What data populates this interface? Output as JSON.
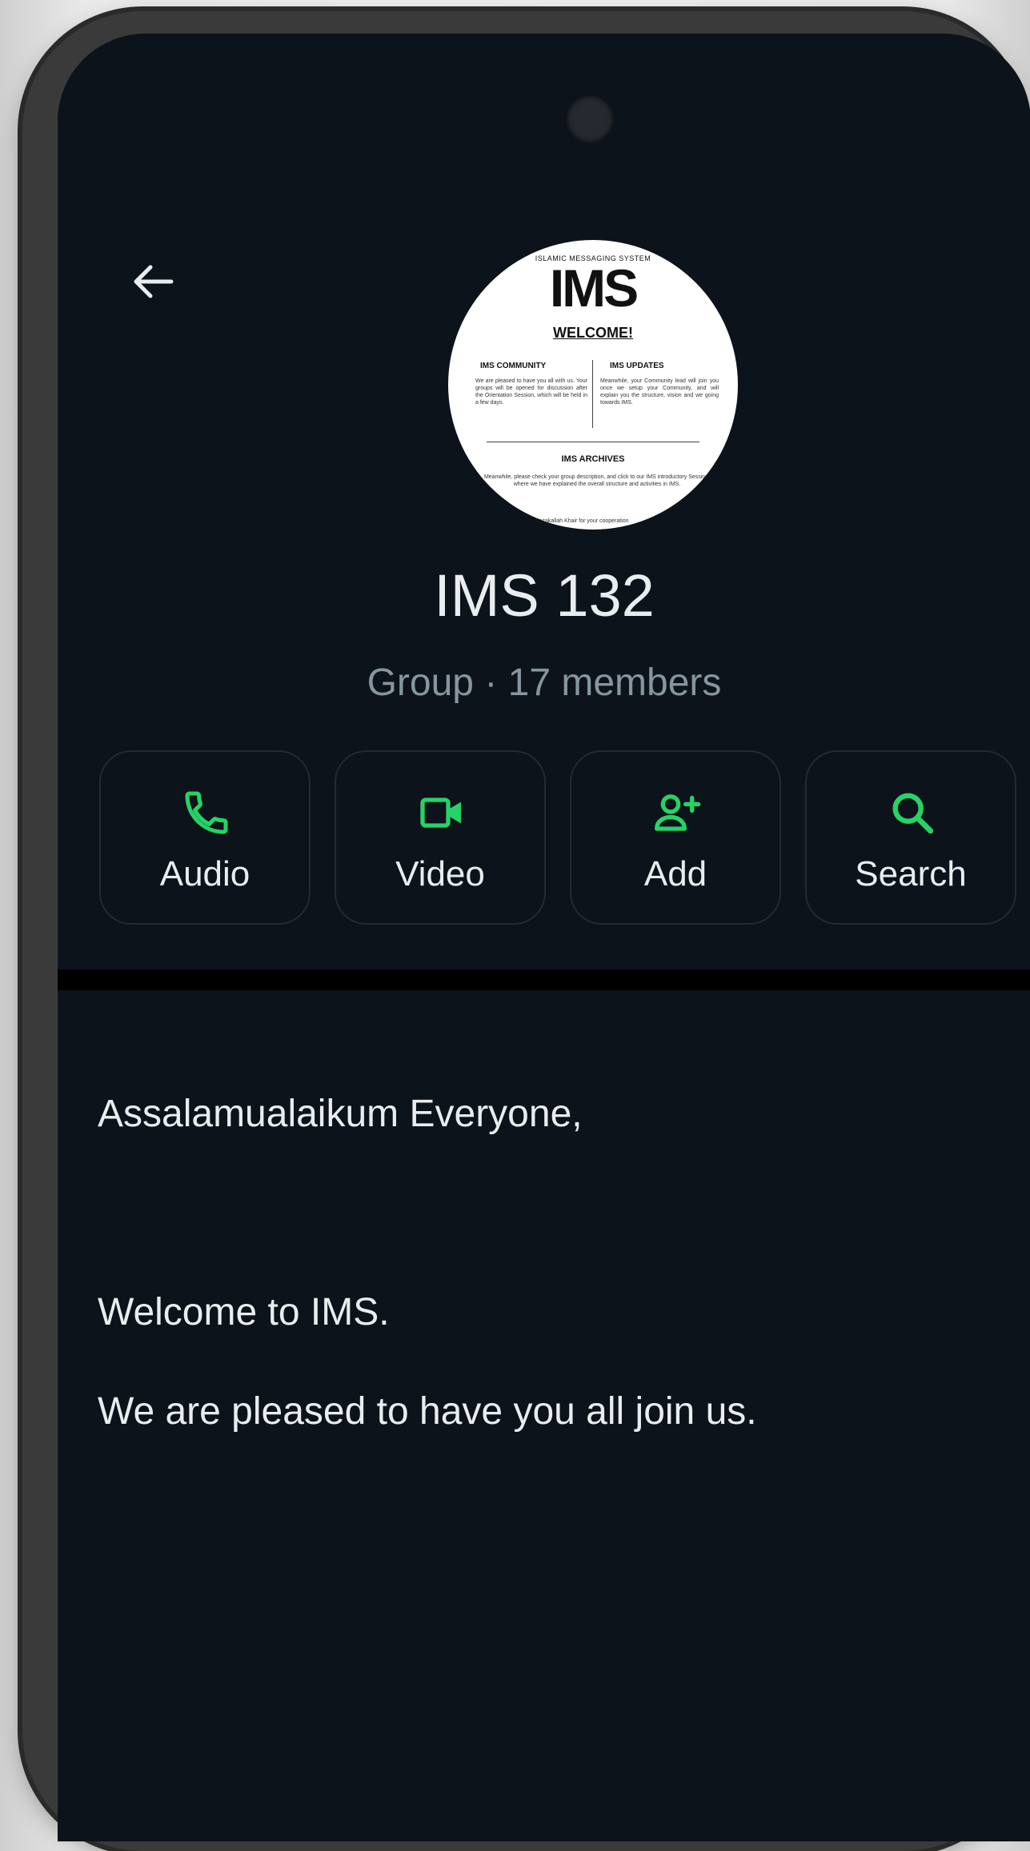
{
  "group": {
    "title": "IMS 132",
    "subtitle": "Group · 17 members"
  },
  "avatar": {
    "logo_text": "IMS",
    "small_top": "ISLAMIC MESSAGING SYSTEM",
    "welcome": "WELCOME!",
    "community_head": "IMS COMMUNITY",
    "community_text": "We are pleased to have you all with us. Your groups will be opened for discussion after the Orientation Session, which will be held in a few days.",
    "updates_head": "IMS UPDATES",
    "updates_text": "Meanwhile, your Community lead will join you once we setup your Community, and will explain you the structure, vision and we going towards IMS.",
    "archives_head": "IMS ARCHIVES",
    "archives_text": "Meanwhile, please check your group description, and click to our IMS introductory Session, where we have explained the overall structure and activities in IMS.",
    "tail_text": "Jazakallah Khair for your cooperation"
  },
  "actions": [
    {
      "label": "Audio",
      "icon": "phone-icon"
    },
    {
      "label": "Video",
      "icon": "video-icon"
    },
    {
      "label": "Add",
      "icon": "add-person-icon"
    },
    {
      "label": "Search",
      "icon": "search-icon"
    }
  ],
  "description": {
    "line1": "Assalamualaikum Everyone,",
    "line2": "Welcome to IMS.",
    "line3": "We are pleased to have you all join us."
  },
  "colors": {
    "background": "#0d131a",
    "accent": "#25d366",
    "text": "#e9edef",
    "muted": "#8696a0"
  }
}
